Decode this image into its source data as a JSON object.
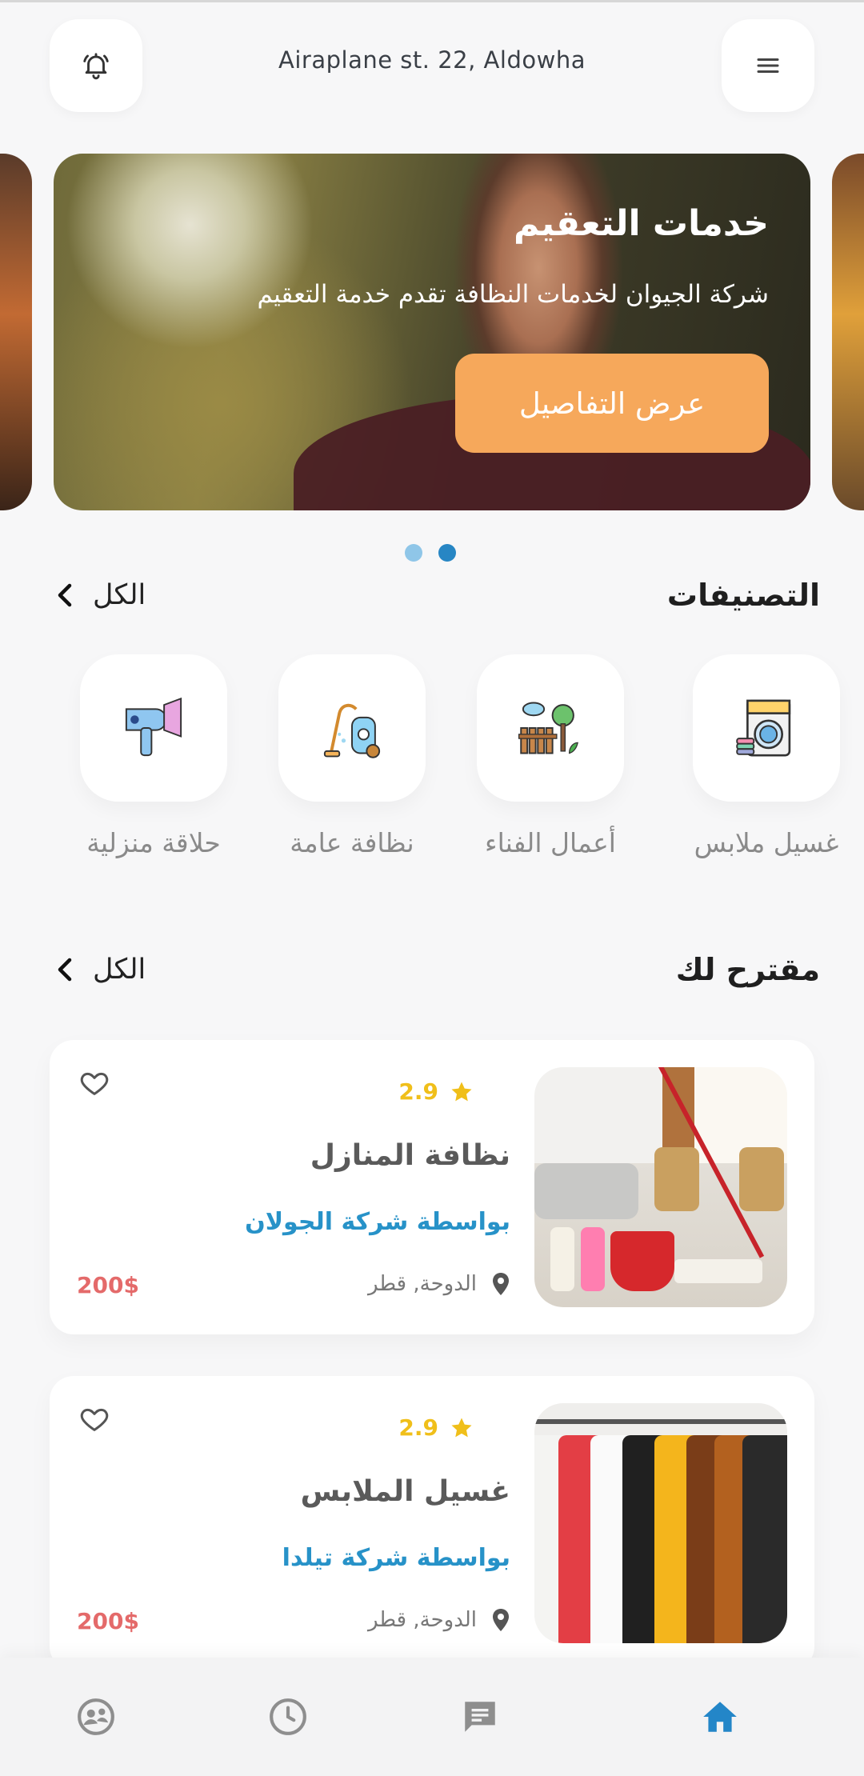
{
  "header": {
    "address": "Airaplane st. 22, Aldowha",
    "icons": [
      "bell-icon",
      "menu-icon"
    ]
  },
  "banner": {
    "title": "خدمات التعقيم",
    "subtitle": "شركة الجيوان لخدمات النظافة تقدم خدمة التعقيم",
    "button_label": "عرض التفاصيل",
    "button_color": "#f6a85b",
    "pagination": {
      "count": 2,
      "active_index": 1
    }
  },
  "categories": {
    "title": "التصنيفات",
    "see_all": "الكل",
    "items": [
      {
        "label": "غسيل ملابس",
        "icon": "washing-machine-icon"
      },
      {
        "label": "أعمال الفناء",
        "icon": "garden-fence-icon"
      },
      {
        "label": "نظافة عامة",
        "icon": "vacuum-cleaner-icon"
      },
      {
        "label": "حلاقة منزلية",
        "icon": "hair-dryer-icon"
      }
    ]
  },
  "suggested": {
    "title": "مقترح لك",
    "see_all": "الكل",
    "cards": [
      {
        "rating": "2.9",
        "title": "نظافة المنازل",
        "company": "بواسطة شركة الجولان",
        "location": "الدوحة, قطر",
        "price": "200$",
        "image": "house-cleaning-photo"
      },
      {
        "rating": "2.9",
        "title": "غسيل الملابس",
        "company": "بواسطة شركة تيلدا",
        "location": "الدوحة, قطر",
        "price": "200$",
        "image": "hanging-shirts-photo"
      }
    ]
  },
  "bottom_nav": {
    "items": [
      "profile-icon",
      "history-clock-icon",
      "chat-icon",
      "home-icon"
    ],
    "active": "home-icon",
    "active_color": "#2386c8",
    "inactive_color": "#8e8e8e"
  },
  "colors": {
    "accent_blue": "#2792c8",
    "rating_yellow": "#f0bf1a",
    "price_red": "#e46a6a",
    "dot_active": "#2786c4",
    "dot_inactive": "#8fc6e8"
  }
}
